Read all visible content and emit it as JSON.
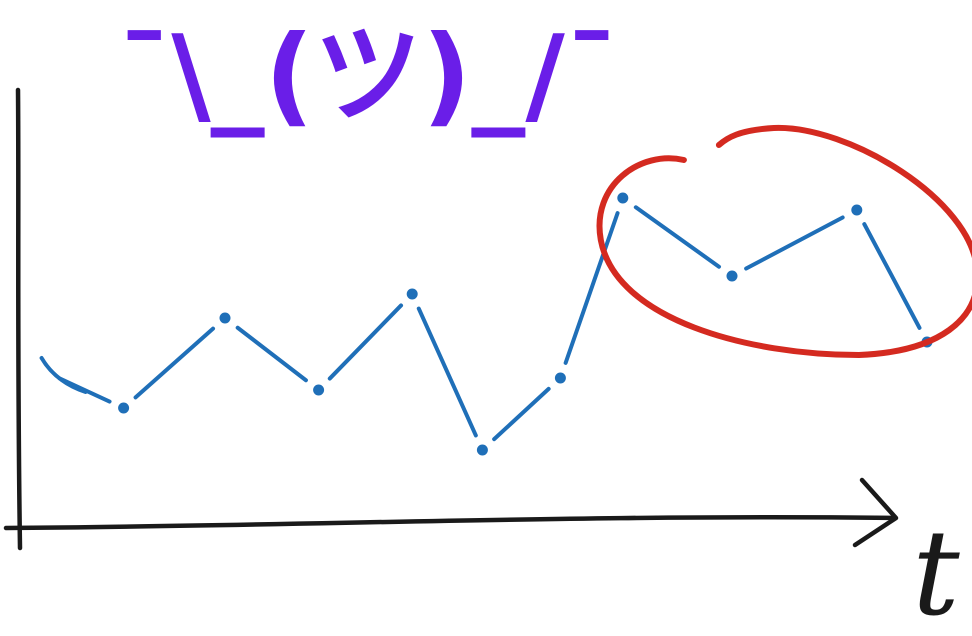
{
  "header_text": "¯\\_(ツ)_/¯",
  "x_axis_label": "t",
  "colors": {
    "background": "#ffffff",
    "ink": "#1a1a1a",
    "series": "#1f6fb8",
    "highlight": "#d42a20",
    "shrug": "#6a1ee8"
  },
  "chart_data": {
    "type": "line",
    "title": "",
    "xlabel": "t",
    "ylabel": "",
    "x": [
      0,
      1,
      2,
      3,
      4,
      5,
      6,
      7,
      8,
      9,
      10,
      11,
      12
    ],
    "series": [
      {
        "values": [
          4.3,
          3.7,
          5.2,
          4.0,
          5.6,
          3.0,
          4.2,
          7.2,
          5.9,
          7.0,
          4.8
        ]
      }
    ],
    "points_x": [
      0,
      1.0,
      2.3,
      3.5,
      4.7,
      5.6,
      6.6,
      7.4,
      8.8,
      10.4,
      11.3
    ],
    "line_style": "dashed",
    "markers": true,
    "highlight": {
      "shape": "ellipse",
      "covers_x_range": [
        7.4,
        11.3
      ]
    },
    "xlim": [
      -0.2,
      12.3
    ],
    "ylim": [
      0,
      10
    ],
    "grid": false,
    "legend": "none",
    "axis_ticks": false
  }
}
